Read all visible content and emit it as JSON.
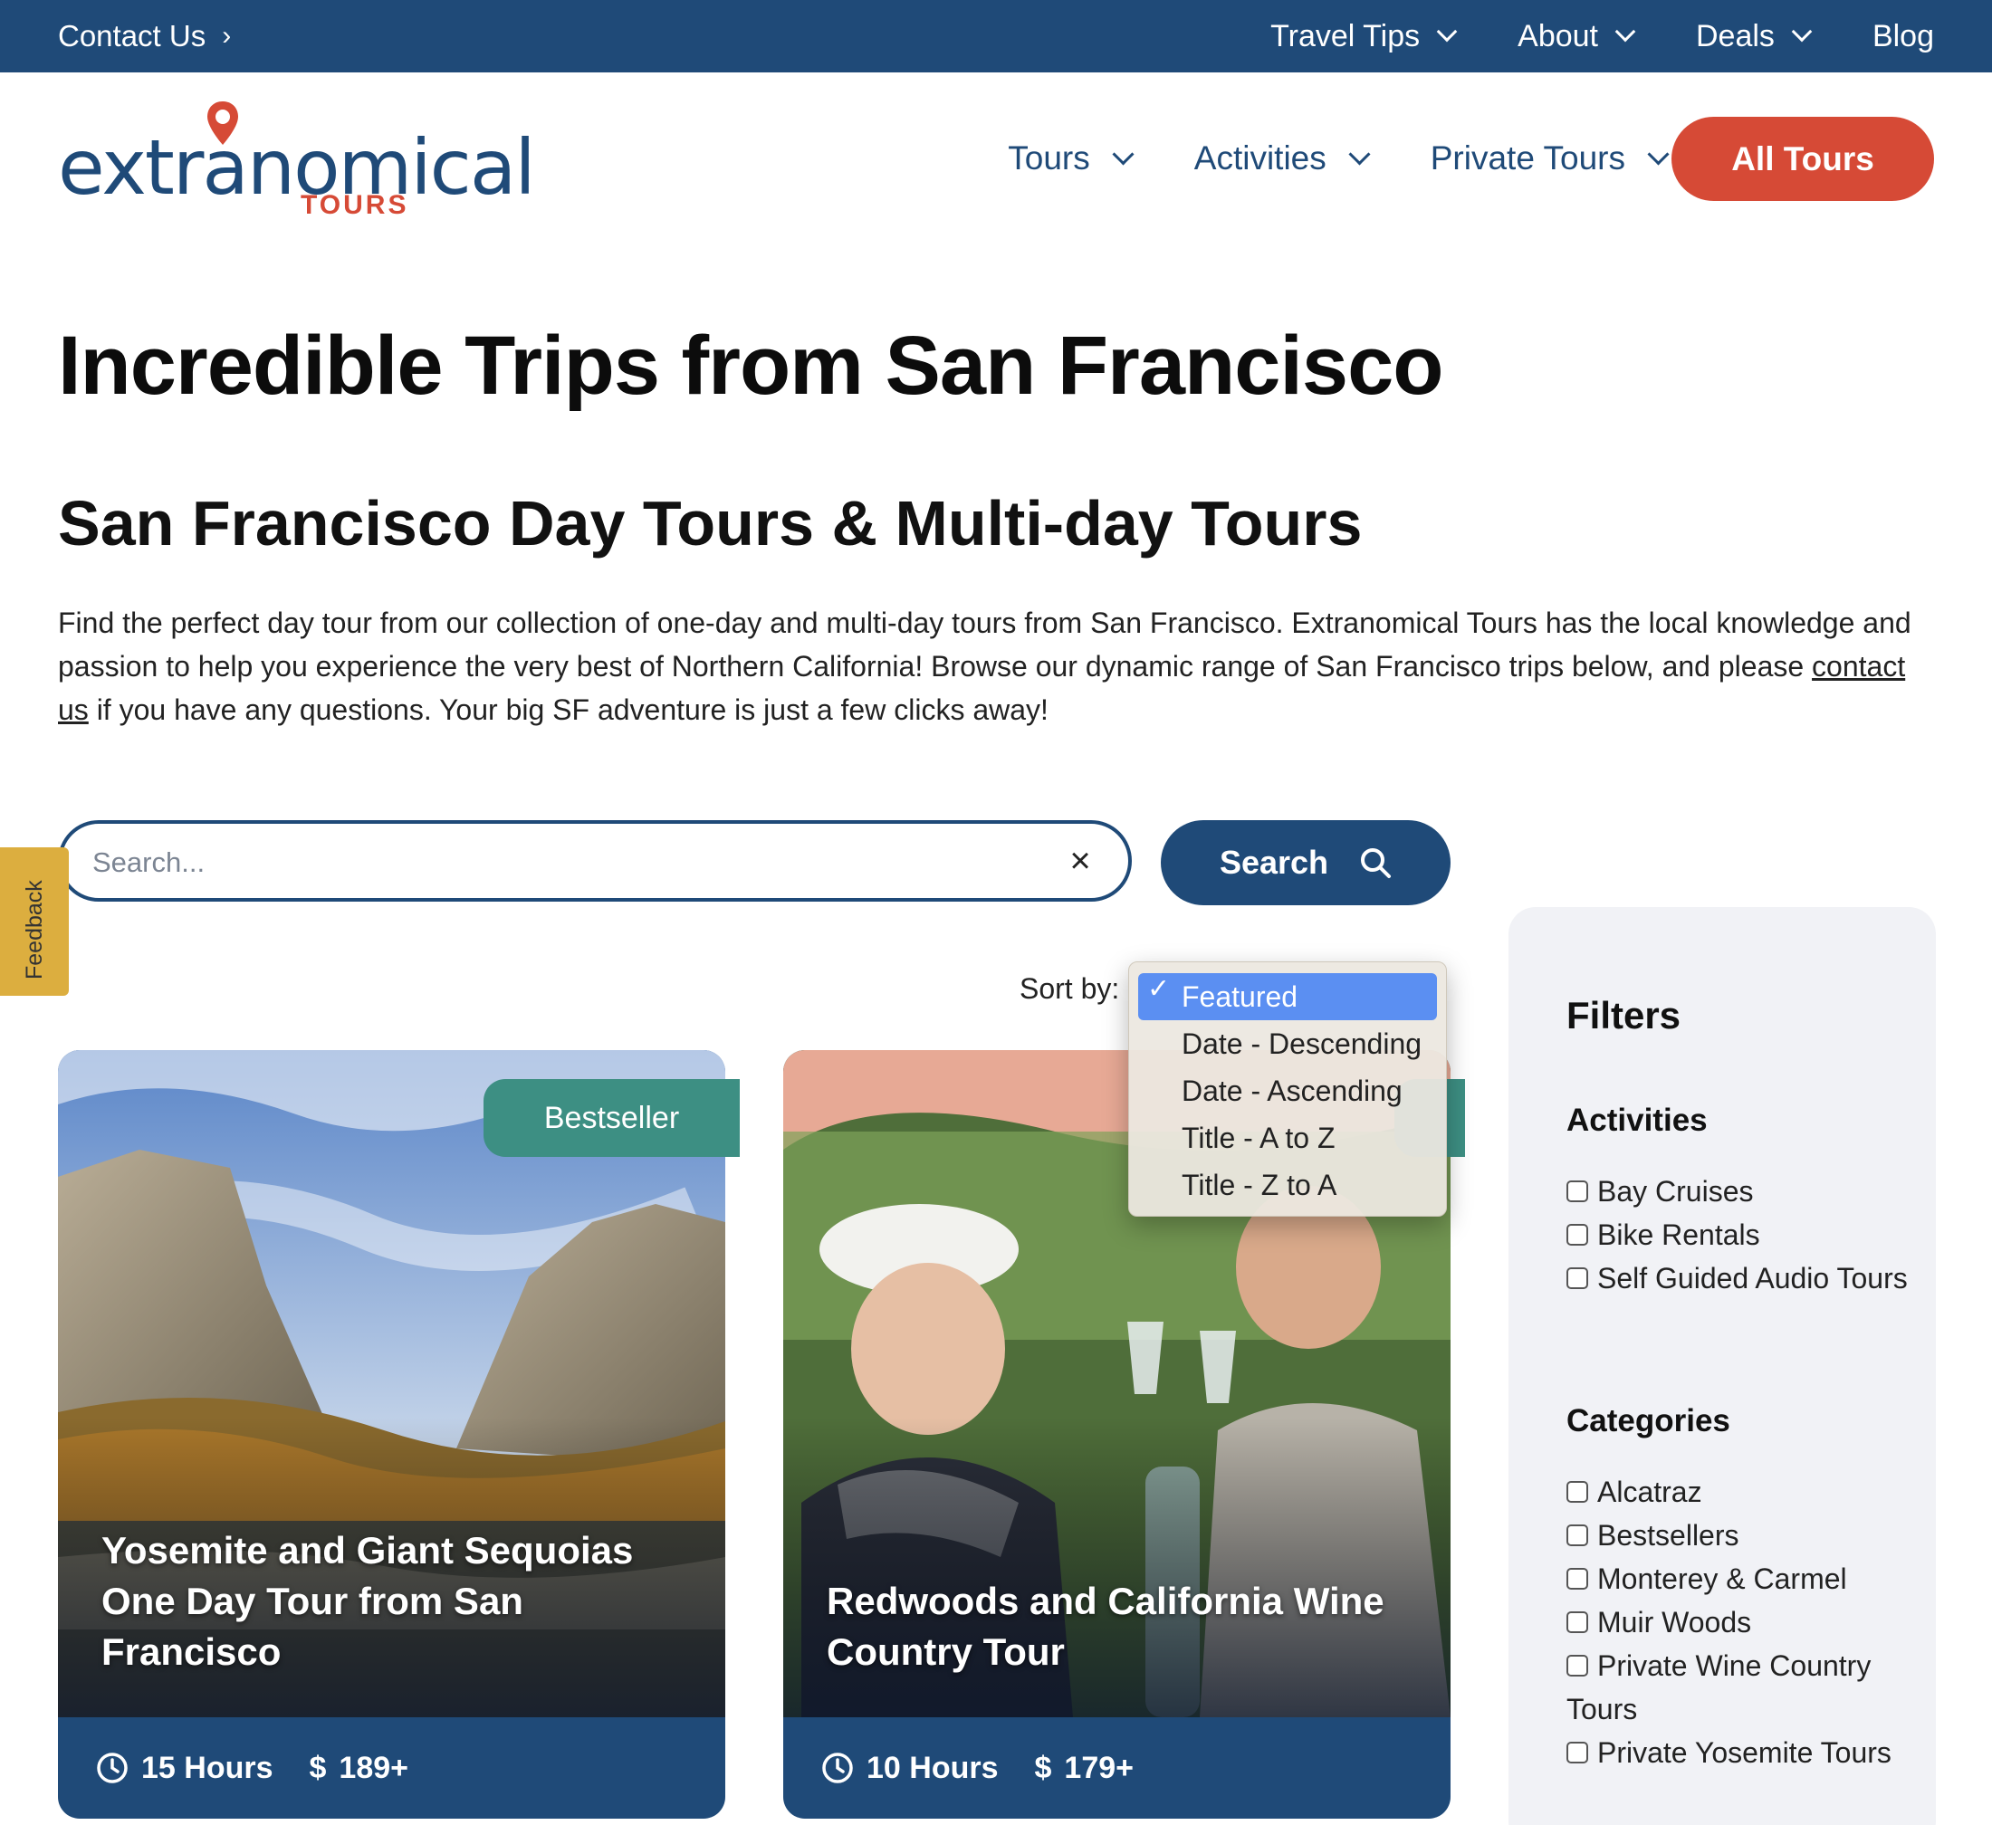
{
  "topbar": {
    "contact_label": "Contact Us",
    "nav": [
      {
        "label": "Travel Tips",
        "has_dropdown": true
      },
      {
        "label": "About",
        "has_dropdown": true
      },
      {
        "label": "Deals",
        "has_dropdown": true
      },
      {
        "label": "Blog",
        "has_dropdown": false
      }
    ]
  },
  "logo": {
    "word": "extranomical",
    "sub": "TOURS"
  },
  "main_nav": [
    {
      "label": "Tours"
    },
    {
      "label": "Activities"
    },
    {
      "label": "Private Tours"
    }
  ],
  "cta": {
    "label": "All Tours"
  },
  "page": {
    "title": "Incredible Trips from San Francisco",
    "subtitle": "San Francisco Day Tours & Multi-day Tours",
    "intro_before": "Find the perfect day tour from our collection of one-day and multi-day tours from San Francisco. Extranomical Tours has the local knowledge and passion to help you experience the very best of Northern California! Browse our dynamic range of San Francisco trips below, and please ",
    "intro_link": "contact us",
    "intro_after": " if you have any questions. Your big SF adventure is just a few clicks away!"
  },
  "search": {
    "placeholder": "Search...",
    "value": "",
    "button_label": "Search"
  },
  "feedback": {
    "label": "Feedback"
  },
  "sort": {
    "label": "Sort by:",
    "selected": "Featured",
    "options": [
      "Featured",
      "Date - Descending",
      "Date - Ascending",
      "Title - A to Z",
      "Title - Z to A"
    ]
  },
  "cards": [
    {
      "title": "Yosemite and Giant Sequoias One Day Tour from San Francisco",
      "badge": "Bestseller",
      "duration": "15 Hours",
      "price": "189+"
    },
    {
      "title": "Redwoods and California Wine Country Tour",
      "badge": "",
      "duration": "10 Hours",
      "price": "179+"
    }
  ],
  "filters": {
    "heading": "Filters",
    "activities": {
      "heading": "Activities",
      "items": [
        "Bay Cruises",
        "Bike Rentals",
        "Self Guided Audio Tours"
      ]
    },
    "categories": {
      "heading": "Categories",
      "items": [
        "Alcatraz",
        "Bestsellers",
        "Monterey & Carmel",
        "Muir Woods",
        "Private Wine Country Tours",
        "Private Yosemite Tours"
      ]
    }
  },
  "colors": {
    "brand_navy": "#1f4a78",
    "brand_red": "#d64a36",
    "badge_teal": "#3d8f83",
    "feedback_gold": "#dcae3f",
    "select_blue": "#5b8ff2"
  }
}
